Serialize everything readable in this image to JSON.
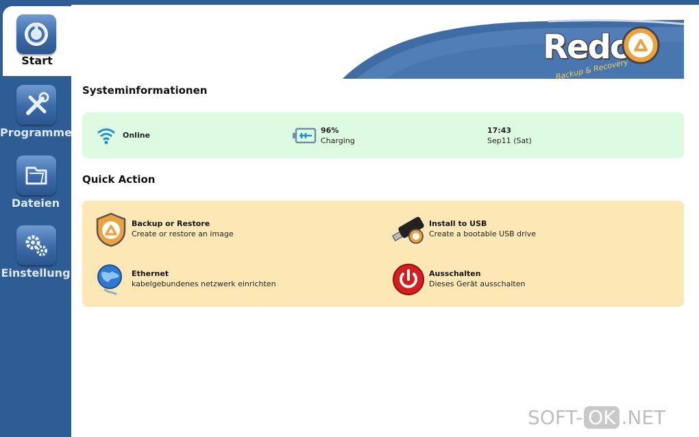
{
  "sidebar": {
    "items": [
      {
        "label": "Start",
        "icon": "power-circle-icon",
        "active": true
      },
      {
        "label": "Programme",
        "icon": "tools-icon",
        "active": false
      },
      {
        "label": "Dateien",
        "icon": "folder-icon",
        "active": false
      },
      {
        "label": "Einstellung",
        "icon": "gears-icon",
        "active": false
      }
    ]
  },
  "brand": {
    "name": "Redo",
    "tagline": "Backup & Recovery"
  },
  "system_info": {
    "title": "Systeminformationen",
    "network": {
      "status": "Online",
      "icon": "wifi-icon"
    },
    "battery": {
      "percent": "96%",
      "state": "Charging",
      "icon": "battery-charging-icon"
    },
    "clock": {
      "time": "17:43",
      "date": "Sep11 (Sat)"
    }
  },
  "quick_action": {
    "title": "Quick Action",
    "items": [
      {
        "title": "Backup or Restore",
        "desc": "Create or restore an image",
        "icon": "recycle-shield-icon"
      },
      {
        "title": "Install to USB",
        "desc": "Create a bootable USB drive",
        "icon": "usb-drive-icon"
      },
      {
        "title": "Ethernet",
        "desc": "kabelgebundenes netzwerk einrichten",
        "icon": "ethernet-globe-icon"
      },
      {
        "title": "Ausschalten",
        "desc": "Dieses Gerät ausschalten",
        "icon": "power-button-icon"
      }
    ]
  },
  "watermark": {
    "prefix": "SOFT-",
    "mid": "OK",
    "suffix": ".NET"
  },
  "colors": {
    "sidebar": "#2e5c94",
    "sysinfo_bg": "#ddfbe0",
    "quick_action_bg": "#fde7b5",
    "logo_orange": "#f0a23a"
  }
}
